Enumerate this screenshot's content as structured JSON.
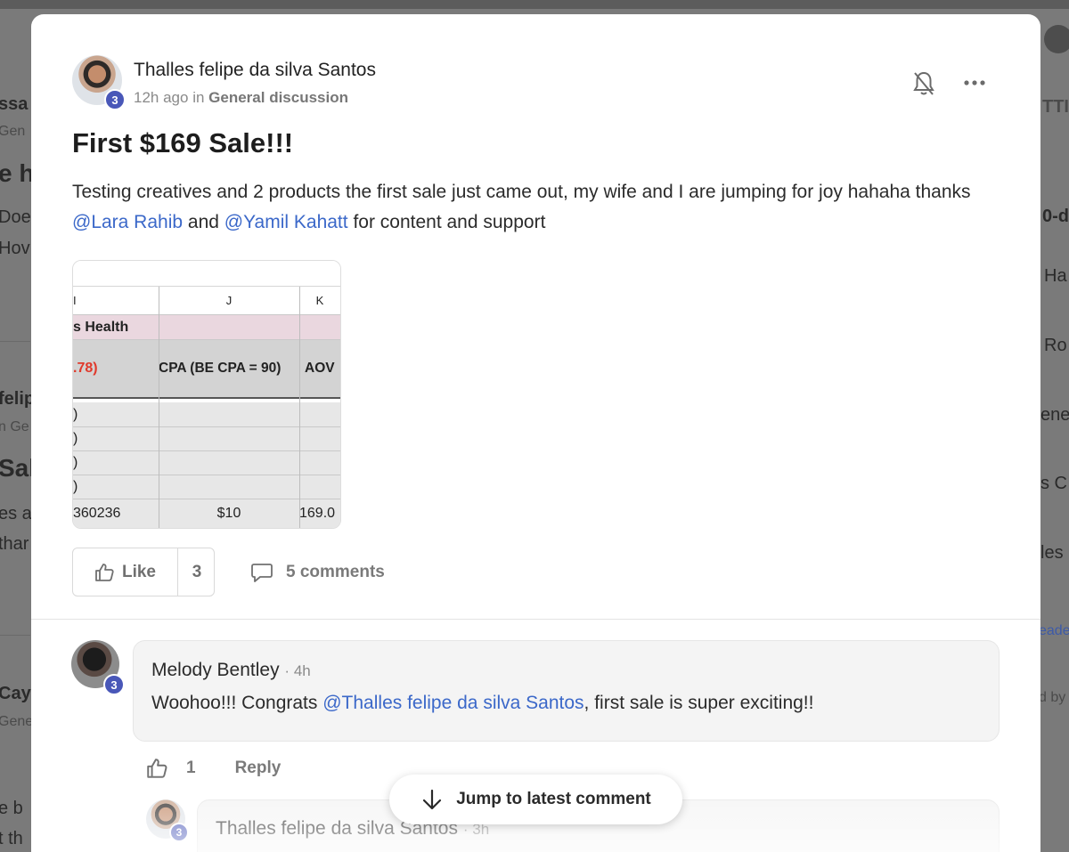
{
  "background": {
    "left_fragments": [
      "ssa",
      "Gen",
      "e h",
      "Doe",
      "Hov",
      "felip",
      "n Ge",
      "Sale",
      "es a",
      "thar",
      "Cay",
      "Gene",
      "e b",
      "t th"
    ],
    "right_fragments": [
      "TTI",
      "0-d",
      "Ha",
      "Ro",
      "ene",
      "s C",
      "les",
      "eade",
      "d by"
    ]
  },
  "post": {
    "author": "Thalles felipe da silva Santos",
    "level": "3",
    "time": "12h ago",
    "in_label": "in",
    "category": "General discussion",
    "title": "First $169 Sale!!!",
    "body_part1": "Testing creatives and 2 products the first sale just came out, my wife and I are jumping for joy hahaha thanks ",
    "mention1": "@Lara Rahib",
    "body_part2": " and ",
    "mention2": "@Yamil Kahatt",
    "body_part3": " for content and support",
    "image": {
      "col_headers": [
        "I",
        "J",
        "K"
      ],
      "section": "s Health",
      "header_left": ".78)",
      "header_mid": "CPA (BE CPA = 90)",
      "header_right": "AOV",
      "empty_rows_left": [
        ")",
        ")",
        ")",
        ")"
      ],
      "total_row": [
        "360236",
        "$10",
        "169.0"
      ]
    },
    "like_label": "Like",
    "like_count": "3",
    "comments_label": "5 comments"
  },
  "comment": {
    "author": "Melody Bentley",
    "time": "4h",
    "level": "3",
    "text_part1": "Woohoo!!! Congrats ",
    "mention": "@Thalles felipe da silva Santos",
    "text_part2": ", first sale is super exciting!!",
    "like_count": "1",
    "reply_label": "Reply"
  },
  "reply": {
    "author": "Thalles felipe da silva Santos",
    "time": "3h",
    "level": "3"
  },
  "jump_label": "Jump to latest comment",
  "colors": {
    "accent": "#4957b8",
    "mention": "#3b68c9"
  }
}
